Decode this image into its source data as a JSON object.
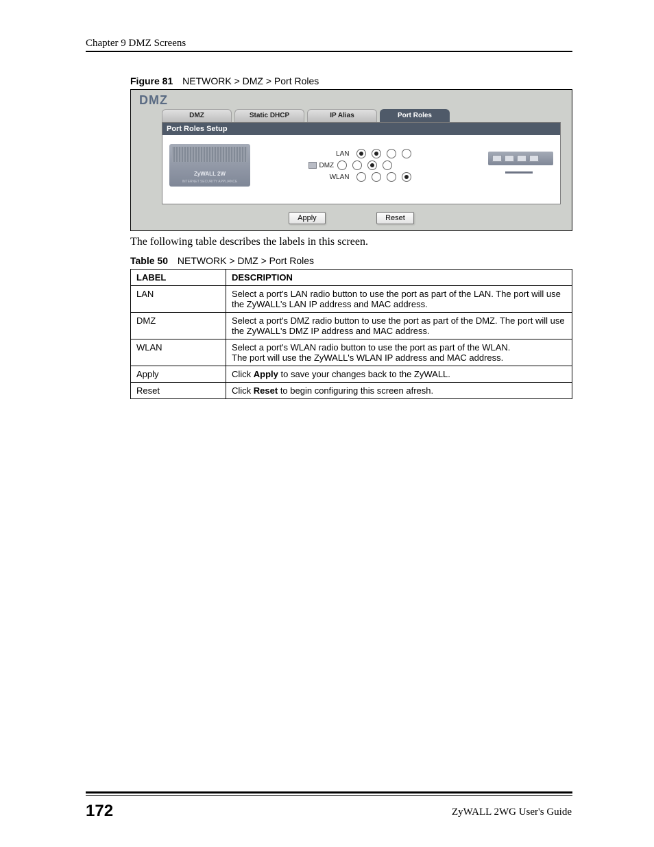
{
  "header": {
    "chapter": "Chapter 9 DMZ Screens"
  },
  "figure": {
    "caption_bold": "Figure 81",
    "caption": "NETWORK > DMZ > Port Roles",
    "title": "DMZ",
    "tabs": [
      "DMZ",
      "Static DHCP",
      "IP Alias",
      "Port Roles"
    ],
    "panel_title": "Port Roles Setup",
    "rows": [
      {
        "label": "LAN",
        "checked": [
          true,
          true,
          false,
          false
        ]
      },
      {
        "label": "DMZ",
        "checked": [
          false,
          false,
          true,
          false
        ]
      },
      {
        "label": "WLAN",
        "checked": [
          false,
          false,
          false,
          true
        ]
      }
    ],
    "device_brand": "ZyWALL 2W",
    "device_line2": "INTERNET SECURITY APPLIANCE",
    "apply": "Apply",
    "reset": "Reset"
  },
  "intro": "The following table describes the labels in this screen.",
  "table": {
    "caption_bold": "Table 50",
    "caption": "NETWORK > DMZ > Port Roles",
    "header": {
      "label": "LABEL",
      "desc": "DESCRIPTION"
    },
    "rows": [
      {
        "label": "LAN",
        "desc": "Select a port's LAN radio button to use the port as part of the LAN. The port will use the ZyWALL's LAN IP address and MAC address."
      },
      {
        "label": "DMZ",
        "desc": "Select a port's DMZ radio button to use the port as part of the DMZ. The port will use the ZyWALL's DMZ IP address and MAC address."
      },
      {
        "label": "WLAN",
        "desc_line1": "Select a port's WLAN radio button to use the port as part of the WLAN.",
        "desc_line2": "The port will use the ZyWALL's WLAN IP address and MAC address."
      },
      {
        "label": "Apply",
        "desc_pre": "Click ",
        "desc_bold": "Apply",
        "desc_post": " to save your changes back to the ZyWALL."
      },
      {
        "label": "Reset",
        "desc_pre": "Click ",
        "desc_bold": "Reset",
        "desc_post": " to begin configuring this screen afresh."
      }
    ]
  },
  "footer": {
    "page": "172",
    "guide": "ZyWALL 2WG User's Guide"
  }
}
